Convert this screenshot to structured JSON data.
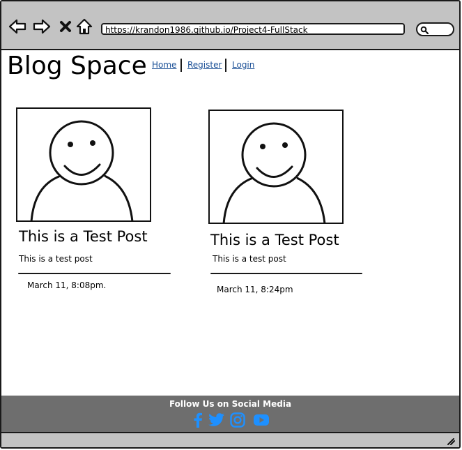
{
  "browser": {
    "url": "https://krandon1986.github.io/Project4-FullStack",
    "icons": [
      "back-arrow-icon",
      "forward-arrow-icon",
      "close-x-icon",
      "home-icon",
      "search-icon"
    ]
  },
  "header": {
    "brand": "Blog Space",
    "nav": [
      "Home",
      "Register",
      "Login"
    ]
  },
  "posts": [
    {
      "title": "This is a Test Post",
      "body": "This is a test post",
      "date": "March 11, 8:08pm."
    },
    {
      "title": "This is a Test Post",
      "body": "This is a test post",
      "date": "March 11, 8:24pm"
    }
  ],
  "footer": {
    "title": "Follow Us on Social Media",
    "icons": [
      "facebook-icon",
      "twitter-icon",
      "instagram-icon",
      "youtube-icon"
    ],
    "icon_color": "#1e90ff",
    "background": "#6e6e6e"
  },
  "colors": {
    "chrome": "#c3c3c3",
    "link": "#1a4f96"
  }
}
